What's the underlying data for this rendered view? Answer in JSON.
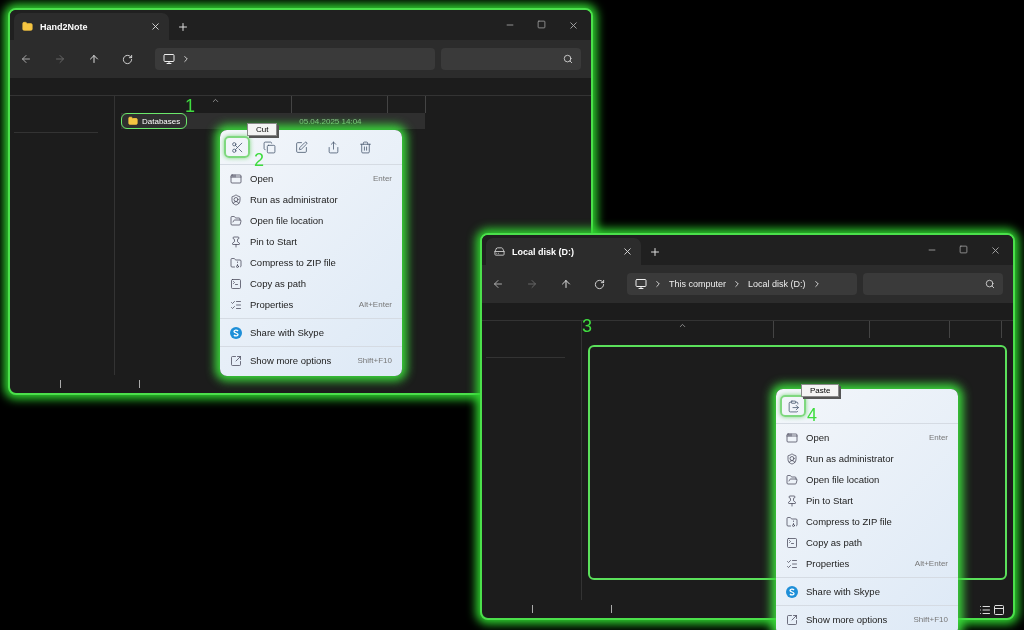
{
  "windows": [
    {
      "kind": "folder",
      "tab_title": "Hand2Note",
      "files": [
        {
          "name": "Databases",
          "date": "05.04.2025 14:04",
          "selected": true
        }
      ],
      "step": "1"
    },
    {
      "kind": "drive",
      "tab_title": "Local disk (D:)",
      "breadcrumb": [
        "This computer",
        "Local disk (D:)"
      ],
      "drop_zone": true,
      "step": "3"
    }
  ],
  "menus": [
    {
      "tooltip": "Cut",
      "step": "2",
      "toolbar": [
        {
          "kind": "cut",
          "selected": true
        },
        {
          "kind": "copy",
          "selected": false
        },
        {
          "kind": "rename",
          "selected": false
        },
        {
          "kind": "share",
          "selected": false
        },
        {
          "kind": "delete",
          "selected": false
        }
      ],
      "groups": [
        [
          {
            "kind": "open",
            "label": "Open",
            "shortcut": "Enter"
          },
          {
            "kind": "admin",
            "label": "Run as administrator"
          },
          {
            "kind": "location",
            "label": "Open file location"
          },
          {
            "kind": "pin",
            "label": "Pin to Start"
          },
          {
            "kind": "zip",
            "label": "Compress to ZIP file"
          },
          {
            "kind": "path",
            "label": "Copy as path"
          },
          {
            "kind": "properties",
            "label": "Properties",
            "shortcut": "Alt+Enter"
          }
        ],
        [
          {
            "kind": "skype",
            "label": "Share with Skype"
          }
        ],
        [
          {
            "kind": "more",
            "label": "Show more options",
            "shortcut": "Shift+F10"
          }
        ]
      ]
    },
    {
      "tooltip": "Paste",
      "step": "4",
      "toolbar": [
        {
          "kind": "paste",
          "selected": true
        }
      ],
      "groups": [
        [
          {
            "kind": "open",
            "label": "Open",
            "shortcut": "Enter"
          },
          {
            "kind": "admin",
            "label": "Run as administrator"
          },
          {
            "kind": "location",
            "label": "Open file location"
          },
          {
            "kind": "pin",
            "label": "Pin to Start"
          },
          {
            "kind": "zip",
            "label": "Compress to ZIP file"
          },
          {
            "kind": "path",
            "label": "Copy as path"
          },
          {
            "kind": "properties",
            "label": "Properties",
            "shortcut": "Alt+Enter"
          }
        ],
        [
          {
            "kind": "skype",
            "label": "Share with Skype"
          }
        ],
        [
          {
            "kind": "more",
            "label": "Show more options",
            "shortcut": "Shift+F10"
          }
        ]
      ]
    }
  ]
}
